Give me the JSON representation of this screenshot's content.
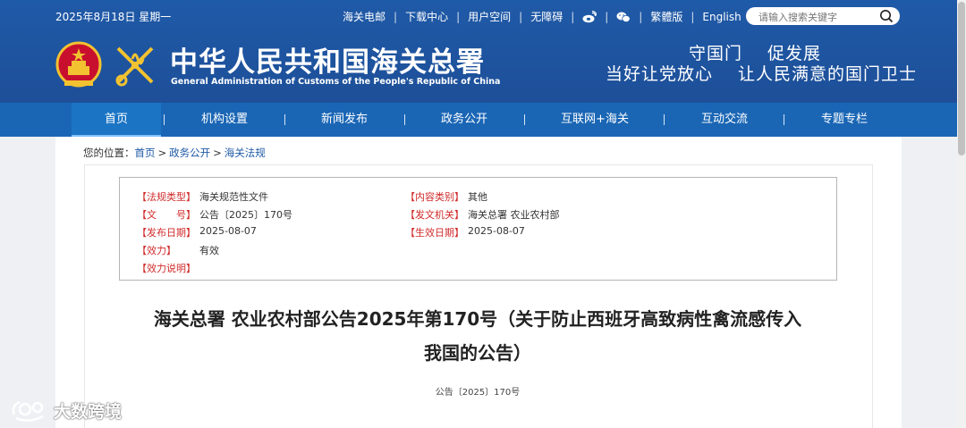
{
  "header": {
    "date": "2025年8月18日 星期一",
    "links": [
      "海关电邮",
      "下载中心",
      "用户空间",
      "无障碍"
    ],
    "lang_links": [
      "繁體版",
      "English"
    ],
    "search_placeholder": "请输入搜索关键字",
    "site_name": "中华人民共和国海关总署",
    "site_name_en": "General Administration of Customs of the People's Republic of China",
    "slogan_line1": [
      "守国门",
      "促发展"
    ],
    "slogan_line2": [
      "当好让党放心",
      "让人民满意的国门卫士"
    ]
  },
  "nav": {
    "items": [
      "首页",
      "机构设置",
      "新闻发布",
      "政务公开",
      "互联网+海关",
      "互动交流",
      "专题专栏"
    ],
    "active": "首页"
  },
  "breadcrumb": {
    "prefix": "您的位置：",
    "items": [
      "首页",
      "政务公开",
      "海关法规"
    ],
    "separator": ">"
  },
  "meta": {
    "type_label": "【法规类型】",
    "type_value": "海关规范性文件",
    "category_label": "【内容类别】",
    "category_value": "其他",
    "docno_label": "【文　　号】",
    "docno_value": "公告〔2025〕170号",
    "issuer_label": "【发文机关】",
    "issuer_value": "海关总署 农业农村部",
    "pubdate_label": "【发布日期】",
    "pubdate_value": "2025-08-07",
    "effdate_label": "【生效日期】",
    "effdate_value": "2025-08-07",
    "validity_label": "【效力】",
    "validity_value": "有效",
    "validity_note_label": "【效力说明】"
  },
  "article": {
    "title_line1": "海关总署 农业农村部公告2025年第170号（关于防止西班牙高致病性禽流感传入",
    "title_line2": "我国的公告）",
    "doc_number": "公告〔2025〕170号"
  },
  "watermark": {
    "text": "大数跨境"
  },
  "colors": {
    "header_bg": "#1f5aa8",
    "nav_bg": "#1a66b5",
    "label_red": "#d12b2b",
    "link_blue": "#1f5aa8"
  }
}
